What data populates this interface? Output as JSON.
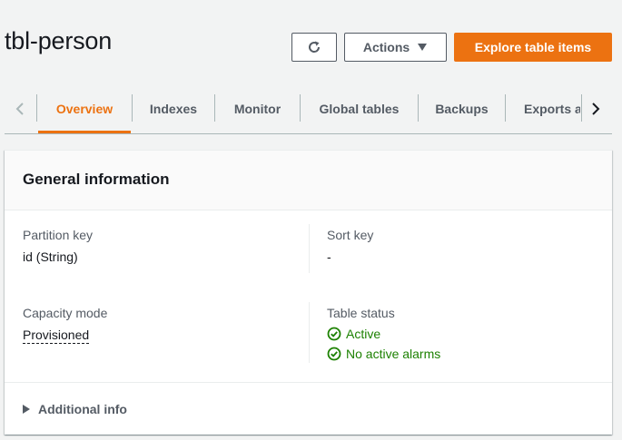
{
  "header": {
    "title": "tbl-person",
    "refresh_icon": "refresh-icon",
    "actions_label": "Actions",
    "explore_label": "Explore table items"
  },
  "tabs": {
    "items": [
      {
        "label": "Overview",
        "active": true
      },
      {
        "label": "Indexes"
      },
      {
        "label": "Monitor"
      },
      {
        "label": "Global tables"
      },
      {
        "label": "Backups"
      },
      {
        "label": "Exports a"
      }
    ]
  },
  "general_info": {
    "title": "General information",
    "partition_key_label": "Partition key",
    "partition_key_value": "id (String)",
    "sort_key_label": "Sort key",
    "sort_key_value": "-",
    "capacity_mode_label": "Capacity mode",
    "capacity_mode_value": "Provisioned",
    "table_status_label": "Table status",
    "status_active": "Active",
    "status_alarms": "No active alarms",
    "additional_info": "Additional info"
  },
  "colors": {
    "primary": "#ec7211",
    "success": "#1d8102"
  }
}
